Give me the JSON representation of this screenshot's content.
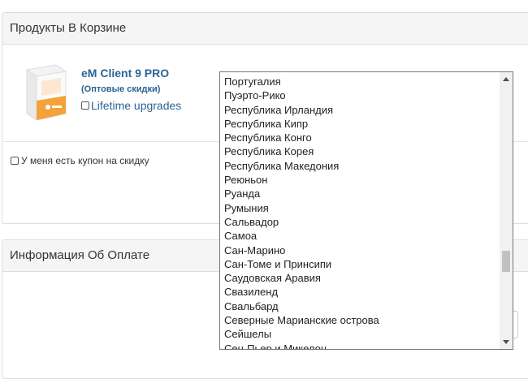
{
  "cart": {
    "heading": "Продукты В Корзине",
    "product": {
      "title": "eM Client 9 PRO",
      "subtitle": "(Оптовые скидки)",
      "lifetime_label": "Lifetime upgrades"
    },
    "coupon_label": "У меня есть купон на скидку"
  },
  "payment": {
    "heading": "Информация Об Оплате"
  },
  "country_dropdown": {
    "options": [
      "Португалия",
      "Пуэрто-Рико",
      "Республика Ирландия",
      "Республика Кипр",
      "Республика Конго",
      "Республика Корея",
      "Республика Македония",
      "Реюньон",
      "Руанда",
      "Румыния",
      "Сальвадор",
      "Самоа",
      "Сан-Марино",
      "Сан-Томе и Принсипи",
      "Саудовская Аравия",
      "Свазиленд",
      "Свальбард",
      "Северные Марианские острова",
      "Сейшелы",
      "Сен-Пьер и Микелон"
    ]
  },
  "icons": {
    "product_image": "product-box-icon",
    "scroll_up": "scroll-up-arrow-icon",
    "scroll_down": "scroll-down-arrow-icon"
  },
  "colors": {
    "link": "#2a6496",
    "panel_heading_bg": "#f5f5f5",
    "border": "#dddddd"
  }
}
